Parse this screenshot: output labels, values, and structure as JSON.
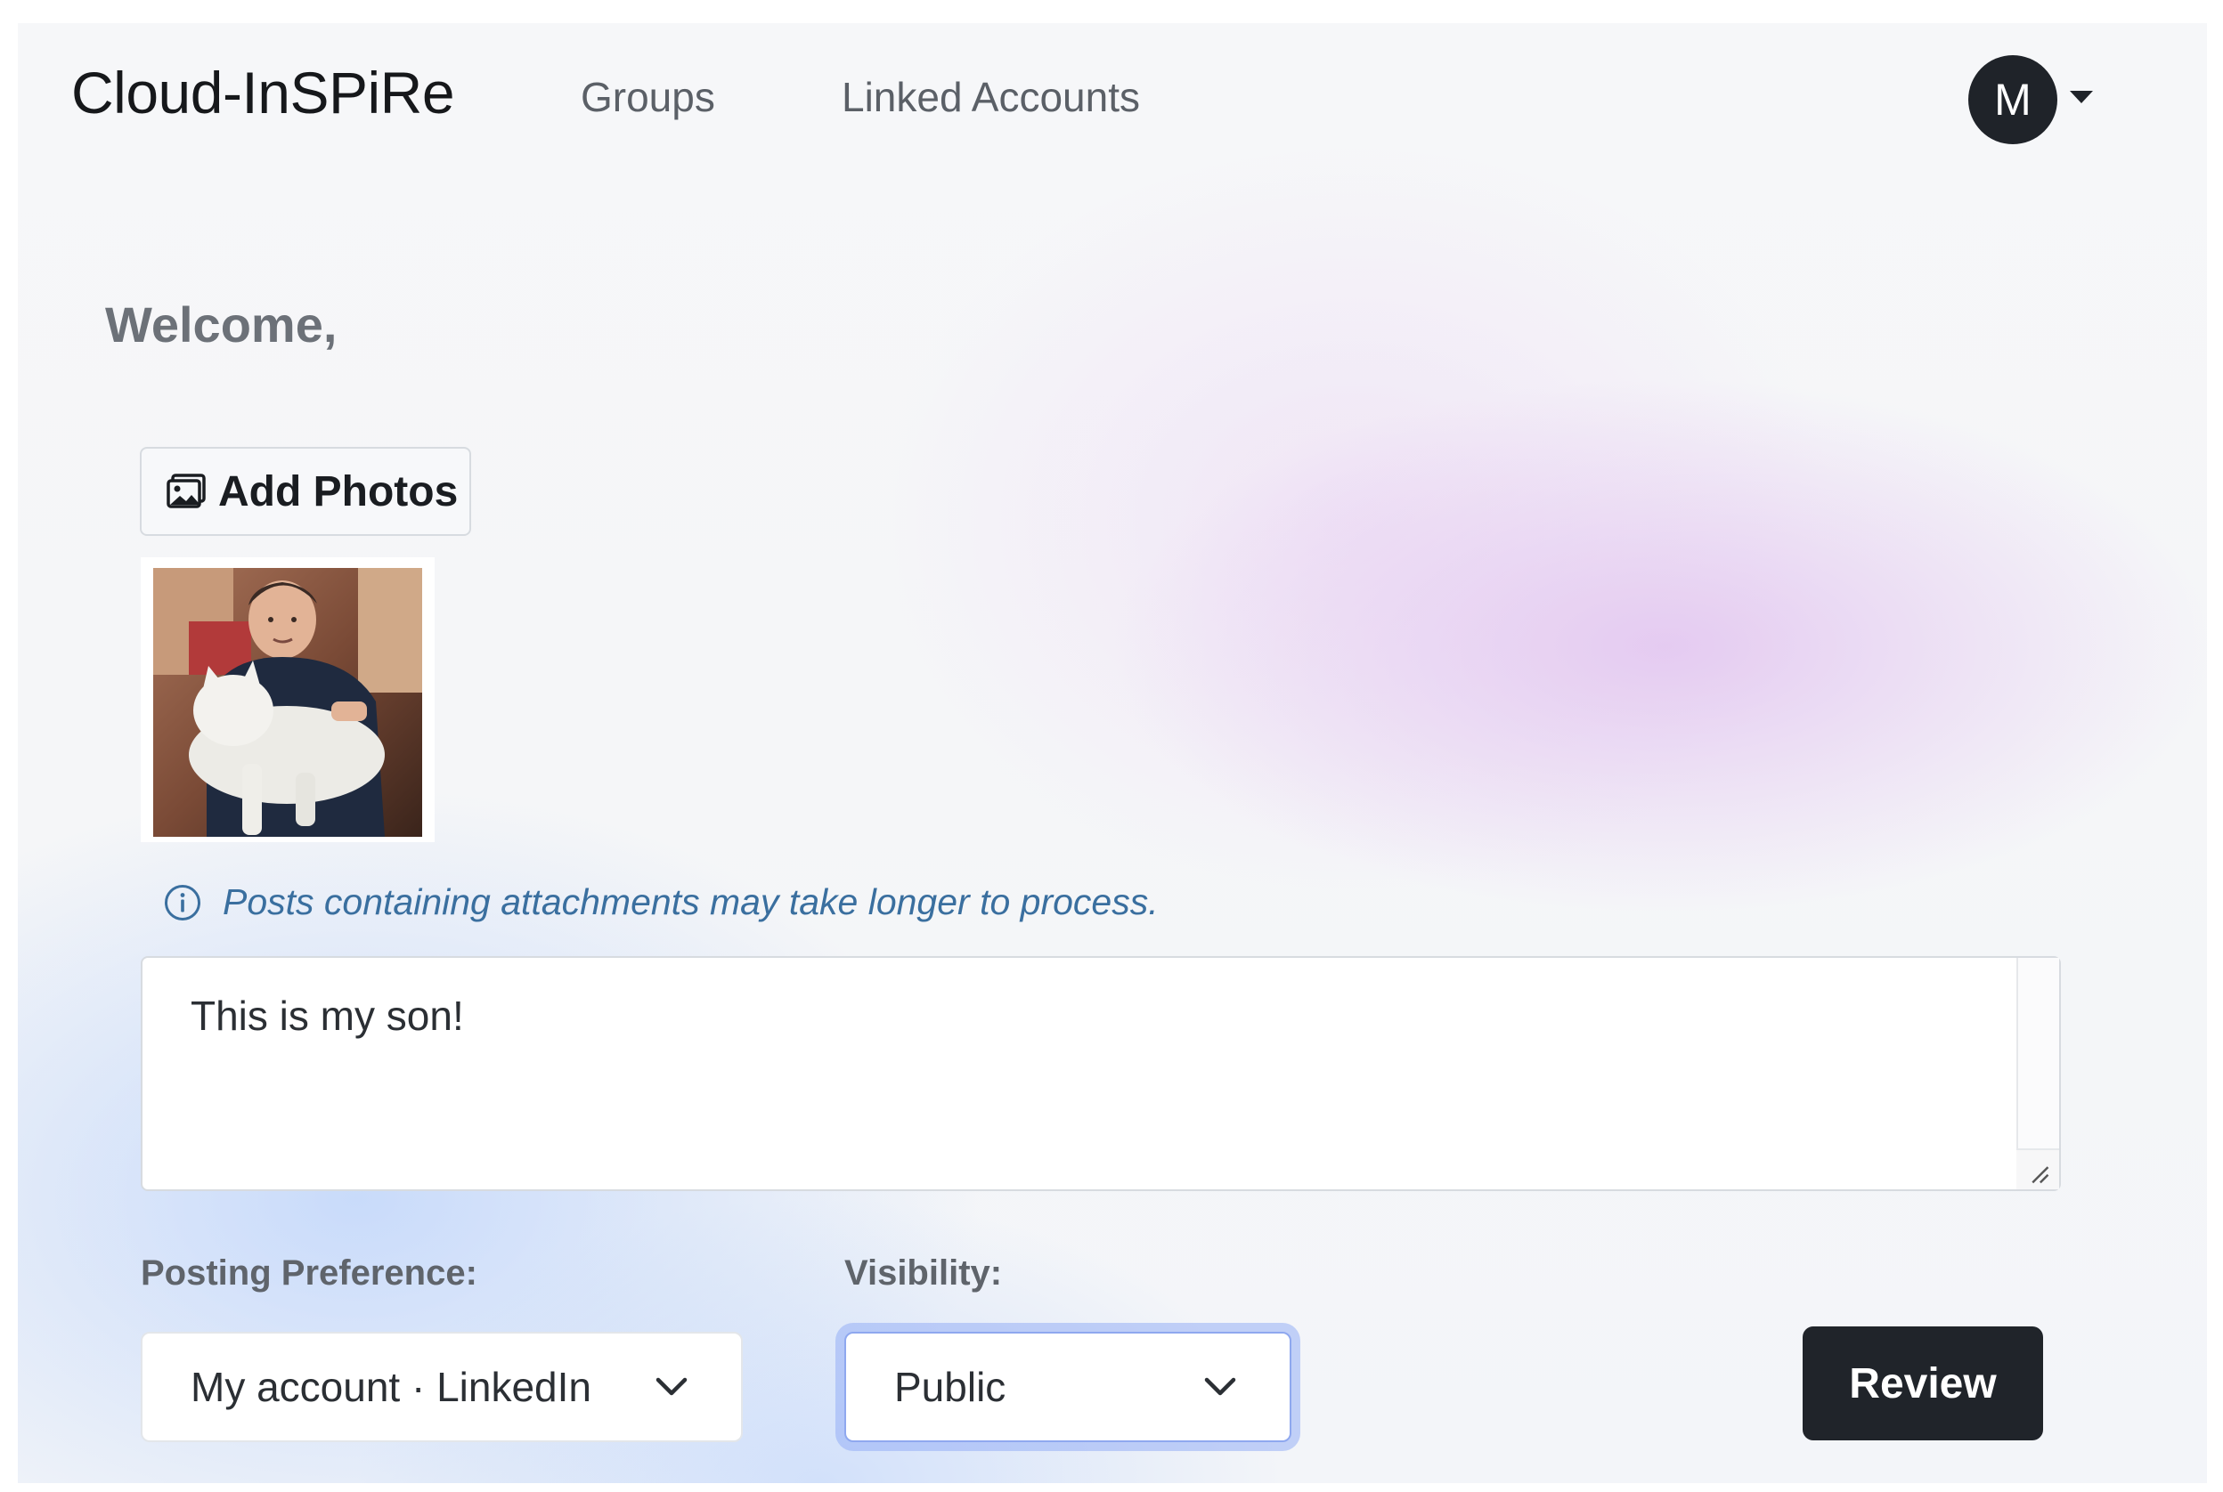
{
  "app": {
    "brand": "Cloud-InSPiRe"
  },
  "nav": {
    "links": [
      {
        "label": "Groups"
      },
      {
        "label": "Linked Accounts"
      }
    ],
    "avatar_initial": "M"
  },
  "main": {
    "welcome": "Welcome,",
    "add_photos_label": "Add Photos",
    "attachments": [
      {
        "alt": "boy holding white cat",
        "icon": "photo-thumbnail"
      }
    ],
    "info_note": "Posts containing attachments may take longer to process.",
    "post_text": "This is my son!"
  },
  "form": {
    "posting_preference_label": "Posting Preference:",
    "posting_preference_value": "My account · LinkedIn",
    "visibility_label": "Visibility:",
    "visibility_value": "Public",
    "review_label": "Review"
  },
  "colors": {
    "primary_dark": "#20242a",
    "info_blue": "#3a6f9f",
    "focus_ring": "#8fa8ef"
  }
}
